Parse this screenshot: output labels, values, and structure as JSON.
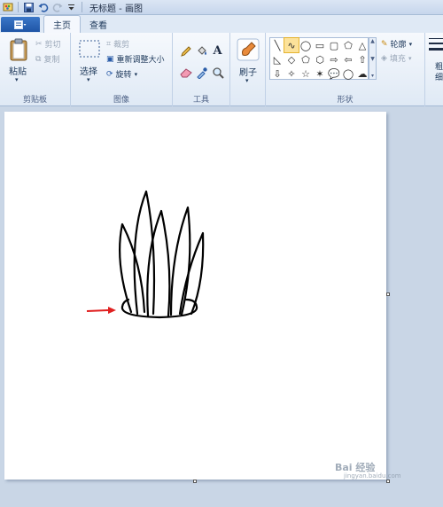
{
  "window": {
    "title": "无标题 - 画图"
  },
  "quick_access": {
    "icons": [
      "paint-app-icon",
      "save-icon",
      "undo-icon",
      "redo-icon",
      "customize-qat-icon"
    ]
  },
  "tabs": {
    "file_menu_icon": "file-menu-icon",
    "home": "主页",
    "view": "查看"
  },
  "ribbon": {
    "clipboard": {
      "paste": "粘贴",
      "cut": "剪切",
      "copy": "复制",
      "group_label": "剪贴板"
    },
    "image": {
      "select": "选择",
      "crop": "裁剪",
      "resize": "重新调整大小",
      "rotate": "旋转",
      "group_label": "图像"
    },
    "tools": {
      "text_tool": "A",
      "group_label": "工具"
    },
    "brushes": {
      "label": "刷子"
    },
    "shapes": {
      "outline": "轮廓",
      "fill": "填充",
      "group_label": "形状"
    },
    "size": {
      "label_partial": "粗\n细"
    }
  },
  "shapes_list": [
    "╲",
    "∿",
    "◯",
    "▭",
    "▢",
    "⬠",
    "△",
    "◺",
    "◇",
    "⬠",
    "⬡",
    "⇨",
    "⇦",
    "⇧",
    "⇩",
    "✧",
    "☆",
    "✶",
    "💬",
    "◯",
    "☁"
  ],
  "annotation_color": "#e02020",
  "watermark": {
    "text": "Bai 经验",
    "sub": "jingyan.baidu.com"
  }
}
